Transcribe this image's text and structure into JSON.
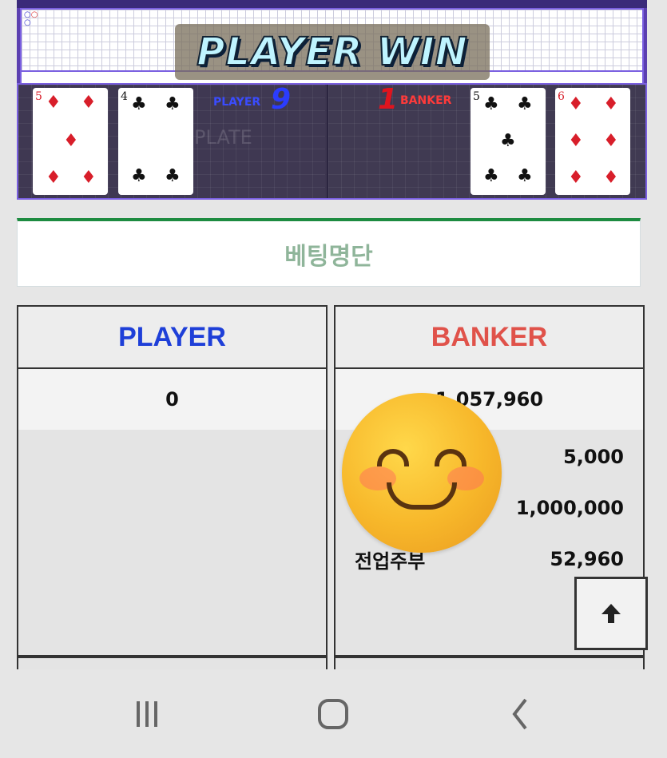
{
  "game": {
    "result_banner": "PLAYER WIN",
    "player_label": "PLAYER",
    "player_score": "9",
    "banker_label": "BANKER",
    "banker_score": "1",
    "table_watermark": "PLATE",
    "player_cards": [
      {
        "rank": "5",
        "suit": "♦",
        "color": "red"
      },
      {
        "rank": "4",
        "suit": "♣",
        "color": "black"
      }
    ],
    "banker_cards": [
      {
        "rank": "5",
        "suit": "♣",
        "color": "black"
      },
      {
        "rank": "6",
        "suit": "♦",
        "color": "red"
      }
    ]
  },
  "betting_list": {
    "title": "베팅명단"
  },
  "columns": {
    "player": {
      "header": "PLAYER",
      "total": "0",
      "rows": []
    },
    "banker": {
      "header": "BANKER",
      "total": "1,057,960",
      "rows": [
        {
          "name": "",
          "amount": "5,000"
        },
        {
          "name": "",
          "amount": "1,000,000"
        },
        {
          "name": "전업주부",
          "amount": "52,960"
        }
      ]
    }
  },
  "colors": {
    "player_blue": "#1e3fd8",
    "banker_red": "#e0524a",
    "accent_green": "#1d8b40"
  },
  "icons": {
    "scroll_top": "arrow-up-icon",
    "overlay": "smiling-face-emoji",
    "nav_recent": "recent-apps-icon",
    "nav_home": "home-icon",
    "nav_back": "back-icon"
  }
}
